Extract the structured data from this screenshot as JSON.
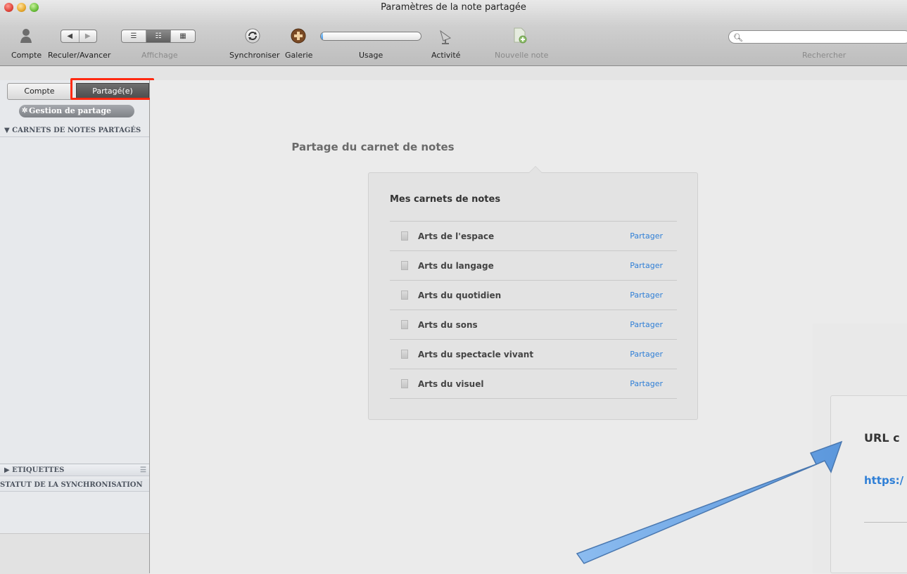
{
  "window": {
    "title": "Paramètres de la note partagée"
  },
  "toolbar": {
    "compte": "Compte",
    "reculer_avancer": "Reculer/Avancer",
    "affichage": "Affichage",
    "synchroniser": "Synchroniser",
    "galerie": "Galerie",
    "usage": "Usage",
    "usage_fraction": 0.02,
    "activite": "Activité",
    "nouvelle_note": "Nouvelle note",
    "rechercher": "Rechercher"
  },
  "sidebar": {
    "tabs": [
      {
        "label": "Compte"
      },
      {
        "label": "Partagé(e)"
      }
    ],
    "gestion": "Gestion de partage",
    "carnets_header": "CARNETS DE NOTES PARTAGÉS",
    "etiquettes_header": "ETIQUETTES",
    "statut_header": "STATUT DE LA SYNCHRONISATION"
  },
  "main": {
    "heading": "Partage du carnet de notes",
    "card_title": "Mes carnets de notes",
    "notebooks": [
      {
        "name": "Arts de l'espace",
        "action": "Partager"
      },
      {
        "name": "Arts du langage",
        "action": "Partager"
      },
      {
        "name": "Arts du quotidien",
        "action": "Partager"
      },
      {
        "name": "Arts du sons",
        "action": "Partager"
      },
      {
        "name": "Arts du spectacle vivant",
        "action": "Partager"
      },
      {
        "name": "Arts du visuel",
        "action": "Partager"
      }
    ],
    "url_title": "URL c",
    "url_link": "https:/"
  },
  "colors": {
    "highlight": "#ff2a12",
    "link": "#2f7fd6",
    "arrow": "#7ab0e8"
  }
}
